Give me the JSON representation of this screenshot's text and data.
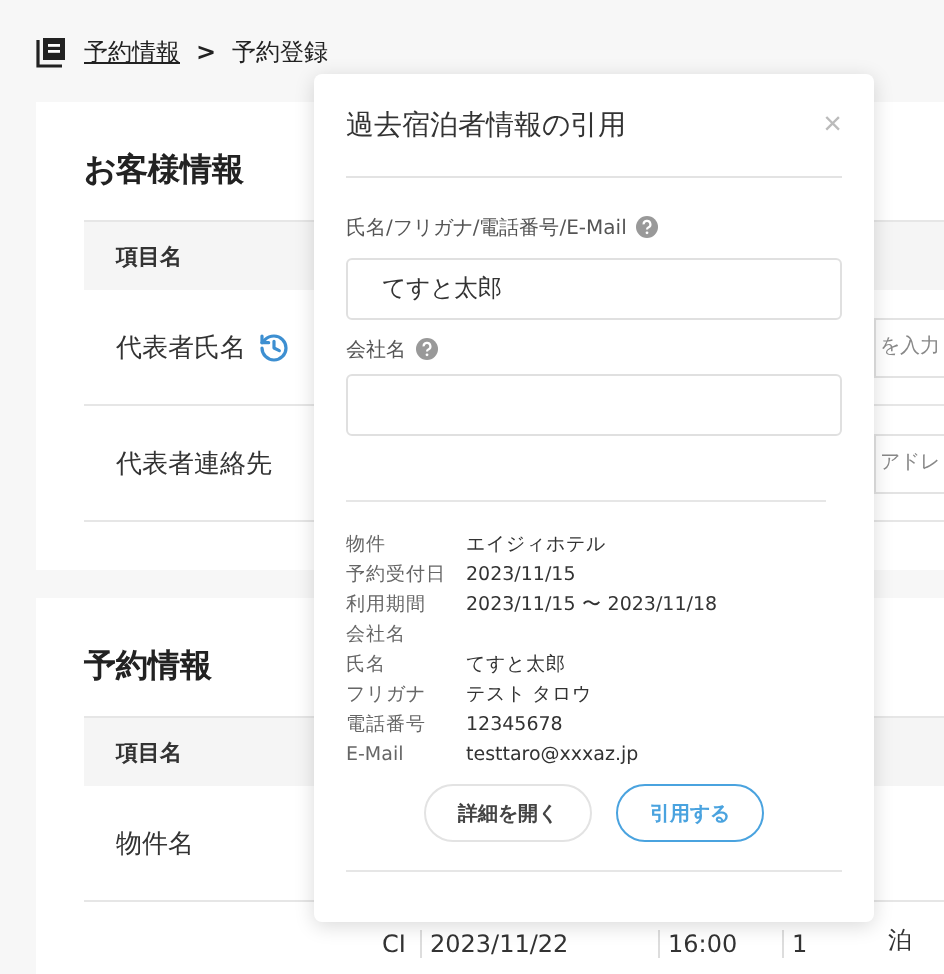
{
  "breadcrumb": {
    "items": [
      {
        "label": "予約情報",
        "link": true
      },
      {
        "label": "予約登録",
        "link": false
      }
    ],
    "separator": ">"
  },
  "sections": [
    {
      "title": "お客様情報",
      "header": "項目名",
      "rows": [
        {
          "label": "代表者氏名",
          "history": true,
          "placeholder": "を入力"
        },
        {
          "label": "代表者連絡先",
          "history": false,
          "placeholder": "アドレ"
        }
      ]
    },
    {
      "title": "予約情報",
      "header": "項目名",
      "rows": [
        {
          "label": "物件名",
          "history": false
        }
      ],
      "stay_row": {
        "cells": [
          "CI",
          "2023/11/22",
          "16:00",
          "1",
          "泊"
        ]
      }
    }
  ],
  "dialog": {
    "title": "過去宿泊者情報の引用",
    "close": "×",
    "fields": [
      {
        "label": "氏名/フリガナ/電話番号/E-Mail",
        "help": true,
        "value": "てすと太郎"
      },
      {
        "label": "会社名",
        "help": true
      }
    ],
    "details": [
      {
        "label": "物件",
        "value": "エイジィホテル"
      },
      {
        "label": "予約受付日",
        "value": "2023/11/15"
      },
      {
        "label": "利用期間",
        "value": "2023/11/15 〜 2023/11/18"
      },
      {
        "label": "会社名"
      },
      {
        "label": "氏名",
        "value": "てすと太郎"
      },
      {
        "label": "フリガナ",
        "value": "テスト タロウ"
      },
      {
        "label": "電話番号",
        "value": "12345678"
      },
      {
        "label": "E-Mail",
        "value": "testtaro@xxxaz.jp"
      }
    ],
    "buttons": [
      {
        "label": "詳細を開く",
        "kind": "secondary"
      },
      {
        "label": "引用する",
        "kind": "primary"
      }
    ]
  }
}
